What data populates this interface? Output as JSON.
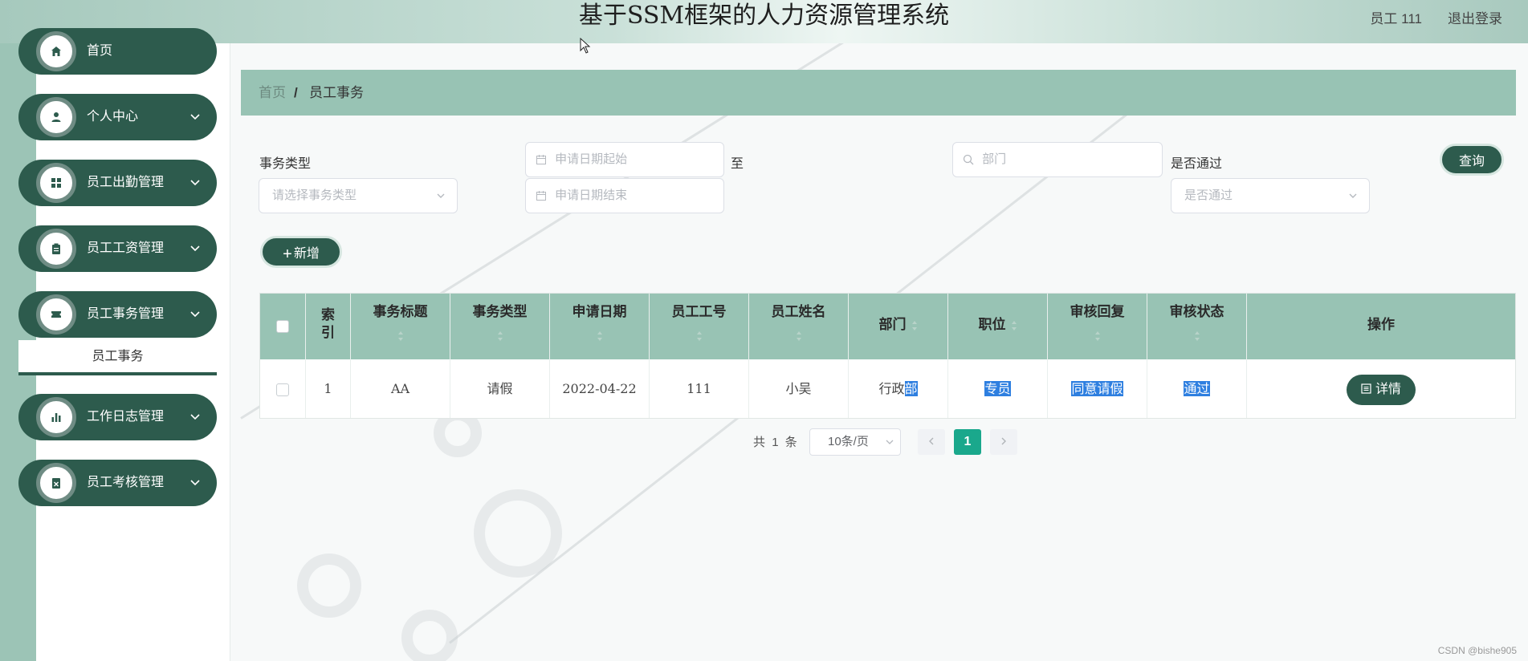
{
  "header": {
    "title": "基于SSM框架的人力资源管理系统",
    "user": "员工 111",
    "logout": "退出登录"
  },
  "sidebar": {
    "items": [
      {
        "label": "首页",
        "icon": "home-icon",
        "expandable": false
      },
      {
        "label": "个人中心",
        "icon": "user-icon",
        "expandable": true
      },
      {
        "label": "员工出勤管理",
        "icon": "grid-icon",
        "expandable": true
      },
      {
        "label": "员工工资管理",
        "icon": "clipboard-icon",
        "expandable": true
      },
      {
        "label": "员工事务管理",
        "icon": "ticket-icon",
        "expandable": true
      },
      {
        "label": "工作日志管理",
        "icon": "bar-chart-icon",
        "expandable": true
      },
      {
        "label": "员工考核管理",
        "icon": "document-x-icon",
        "expandable": true
      }
    ],
    "submenu": {
      "label": "员工事务"
    }
  },
  "breadcrumb": {
    "home": "首页",
    "separator": "/",
    "current": "员工事务"
  },
  "search": {
    "type_label": "事务类型",
    "type_placeholder": "请选择事务类型",
    "date_start_placeholder": "申请日期起始",
    "date_to": "至",
    "date_end_placeholder": "申请日期结束",
    "dept_placeholder": "部门",
    "passed_label": "是否通过",
    "passed_placeholder": "是否通过",
    "query_button": "查询"
  },
  "actions": {
    "add_button": "新增"
  },
  "table": {
    "headers": {
      "index": "索\n引",
      "title": "事务标题",
      "type": "事务类型",
      "date": "申请日期",
      "emp_no": "员工工号",
      "emp_name": "员工姓名",
      "dept": "部门",
      "position": "职位",
      "reply": "审核回复",
      "status": "审核状态",
      "ops": "操作"
    },
    "rows": [
      {
        "index": "1",
        "title": "AA",
        "type": "请假",
        "date": "2022-04-22",
        "emp_no": "111",
        "emp_name": "小吴",
        "dept_a": "行政",
        "dept_b": "部",
        "position": "专员",
        "reply": "同意请假",
        "status": "通过",
        "detail": "详情"
      }
    ]
  },
  "pagination": {
    "total_prefix": "共",
    "total": "1",
    "total_suffix": "条",
    "page_size": "10条/页",
    "current_page": "1"
  },
  "watermark": "CSDN @bishe905",
  "colors": {
    "primary": "#2d5b4d",
    "accent": "#98c3b4",
    "page_active": "#1aa88c",
    "selection": "#2e7fe0"
  }
}
